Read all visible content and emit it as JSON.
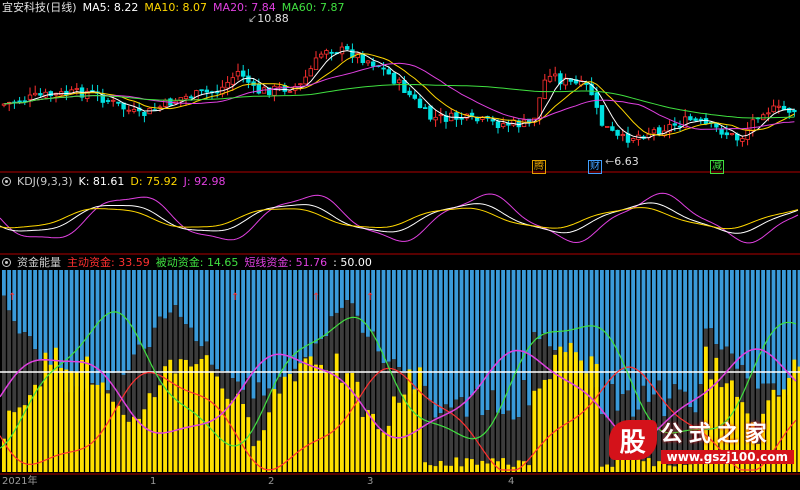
{
  "main_panel": {
    "title": "宜安科技(日线)",
    "ma": [
      {
        "label": "MA5:",
        "value": "8.22",
        "color": "#ffffff"
      },
      {
        "label": "MA10:",
        "value": "8.07",
        "color": "#ffd700"
      },
      {
        "label": "MA20:",
        "value": "7.84",
        "color": "#e040e0"
      },
      {
        "label": "MA60:",
        "value": "7.87",
        "color": "#40e040"
      }
    ],
    "high_label": "10.88",
    "low_label": "6.63",
    "event_flags": [
      {
        "text": "腾",
        "color": "#e0a000"
      },
      {
        "text": "财",
        "color": "#40a0ff"
      },
      {
        "text": "减",
        "color": "#40e040"
      }
    ]
  },
  "kdj_panel": {
    "title": "KDJ(9,3,3)",
    "k": {
      "label": "K:",
      "value": "81.61",
      "color": "#ffffff"
    },
    "d": {
      "label": "D:",
      "value": "75.92",
      "color": "#ffd700"
    },
    "j": {
      "label": "J:",
      "value": "92.98",
      "color": "#e040e0"
    }
  },
  "fund_panel": {
    "title": "资金能量",
    "main": {
      "label": "主动资金:",
      "value": "33.59",
      "color": "#ff3030"
    },
    "passive": {
      "label": "被动资金:",
      "value": "14.65",
      "color": "#40e040"
    },
    "short": {
      "label": "短线资金:",
      "value": "51.76",
      "color": "#e040e0"
    },
    "level": ": 50.00"
  },
  "time_axis": [
    "2021年",
    "1",
    "2",
    "3",
    "4"
  ],
  "watermark": {
    "badge": "股",
    "title": "公式之家",
    "url": "www.gszj100.com"
  },
  "colors": {
    "up": "#ff3030",
    "down": "#00e0e0",
    "bg": "#000000",
    "divider": "#b00000"
  }
}
